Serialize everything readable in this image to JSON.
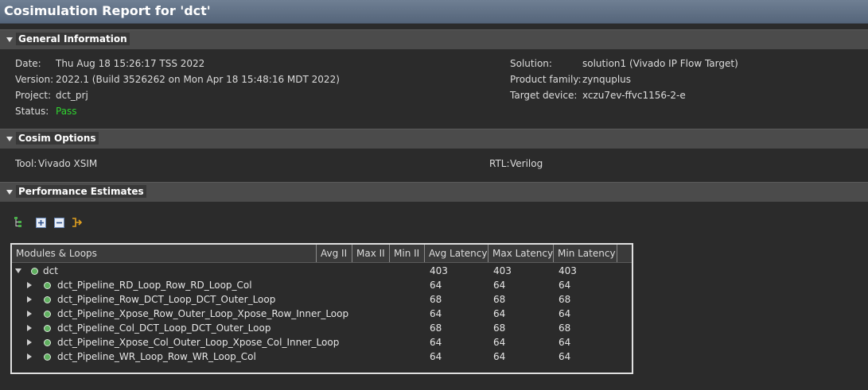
{
  "window": {
    "title": "Cosimulation Report for 'dct'"
  },
  "general": {
    "header": "General Information",
    "left": [
      {
        "label": "Date:",
        "value": "Thu Aug 18 15:26:17 TSS 2022"
      },
      {
        "label": "Version:",
        "value": "2022.1 (Build 3526262 on Mon Apr 18 15:48:16 MDT 2022)"
      },
      {
        "label": "Project:",
        "value": "dct_prj"
      },
      {
        "label": "Status:",
        "value": "Pass"
      }
    ],
    "right": [
      {
        "label": "Solution:",
        "value": "solution1 (Vivado IP Flow Target)"
      },
      {
        "label": "Product family:",
        "value": "zynquplus"
      },
      {
        "label": "Target device:",
        "value": "xczu7ev-ffvc1156-2-e"
      }
    ]
  },
  "cosim": {
    "header": "Cosim Options",
    "tool_label": "Tool:",
    "tool_value": "Vivado XSIM",
    "rtl_label": "RTL:",
    "rtl_value": "Verilog"
  },
  "perf": {
    "header": "Performance Estimates",
    "toolbar": [
      "hierarchy-icon",
      "expand-all-icon",
      "collapse-all-icon",
      "goto-source-icon"
    ],
    "columns": [
      "Modules & Loops",
      "Avg II",
      "Max II",
      "Min II",
      "Avg Latency",
      "Max Latency",
      "Min Latency"
    ],
    "rows": [
      {
        "name": "dct",
        "avg_lat": "403",
        "max_lat": "403",
        "min_lat": "403"
      },
      {
        "name": "dct_Pipeline_RD_Loop_Row_RD_Loop_Col",
        "avg_lat": "64",
        "max_lat": "64",
        "min_lat": "64"
      },
      {
        "name": "dct_Pipeline_Row_DCT_Loop_DCT_Outer_Loop",
        "avg_lat": "68",
        "max_lat": "68",
        "min_lat": "68"
      },
      {
        "name": "dct_Pipeline_Xpose_Row_Outer_Loop_Xpose_Row_Inner_Loop",
        "avg_lat": "64",
        "max_lat": "64",
        "min_lat": "64"
      },
      {
        "name": "dct_Pipeline_Col_DCT_Loop_DCT_Outer_Loop",
        "avg_lat": "68",
        "max_lat": "68",
        "min_lat": "68"
      },
      {
        "name": "dct_Pipeline_Xpose_Col_Outer_Loop_Xpose_Col_Inner_Loop",
        "avg_lat": "64",
        "max_lat": "64",
        "min_lat": "64"
      },
      {
        "name": "dct_Pipeline_WR_Loop_Row_WR_Loop_Col",
        "avg_lat": "64",
        "max_lat": "64",
        "min_lat": "64"
      }
    ]
  }
}
